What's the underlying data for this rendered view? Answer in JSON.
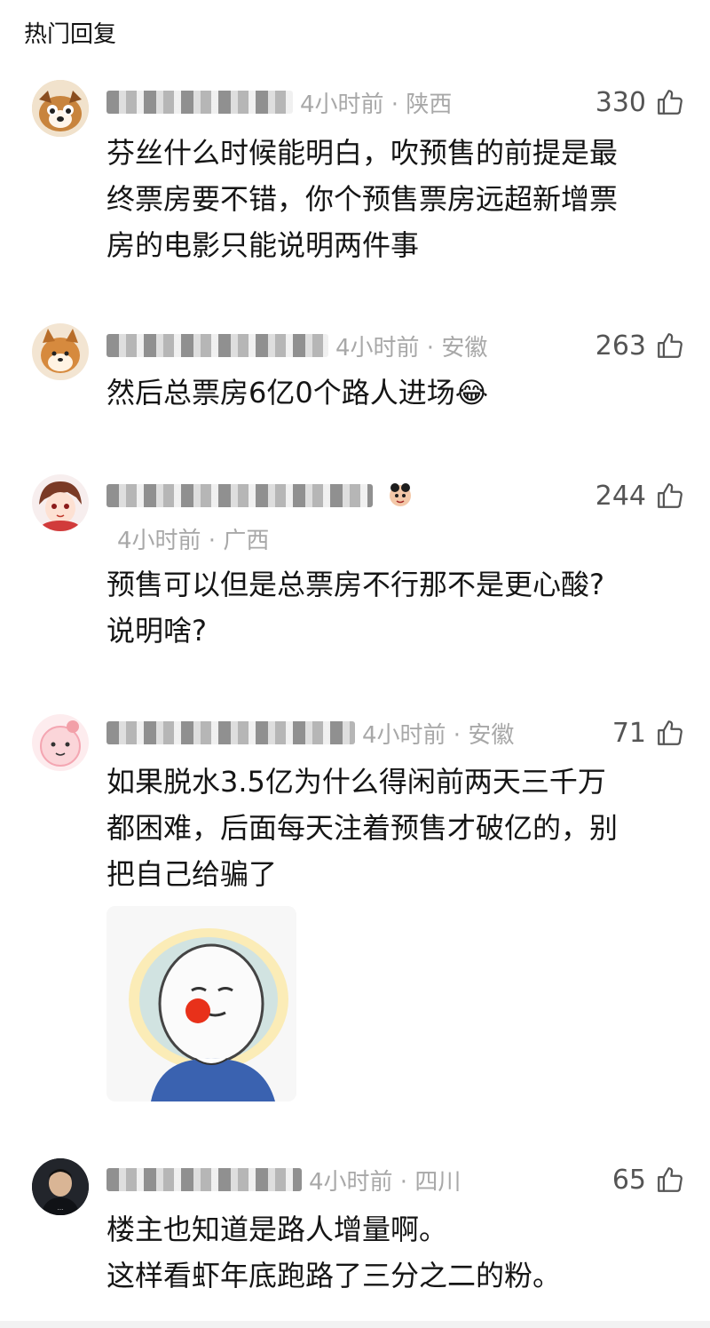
{
  "section": {
    "title": "热门回复"
  },
  "comments": [
    {
      "meta": "4小时前 · 陕西",
      "likes": "330",
      "lines": [
        "芬丝什么时候能明白，吹预售的前提是最",
        "终票房要不错，你个预售票房远超新增票",
        "房的电影只能说明两件事"
      ]
    },
    {
      "meta": "4小时前 · 安徽",
      "likes": "263",
      "lines": [
        "然后总票房6亿0个路人进场😂"
      ]
    },
    {
      "meta": "4小时前 · 广西",
      "likes": "244",
      "lines": [
        "预售可以但是总票房不行那不是更心酸?",
        "说明啥?"
      ]
    },
    {
      "meta": "4小时前 · 安徽",
      "likes": "71",
      "lines": [
        "如果脱水3.5亿为什么得闲前两天三千万",
        "都困难，后面每天注着预售才破亿的，别",
        "把自己给骗了"
      ]
    },
    {
      "meta": "4小时前 · 四川",
      "likes": "65",
      "lines": [
        "楼主也知道是路人增量啊。",
        "这样看虾年底跑路了三分之二的粉。"
      ]
    }
  ],
  "icons": {
    "like": "thumbs-up-icon"
  },
  "colors": {
    "meta": "#a8a8a8",
    "text": "#151515",
    "likes": "#555555"
  }
}
